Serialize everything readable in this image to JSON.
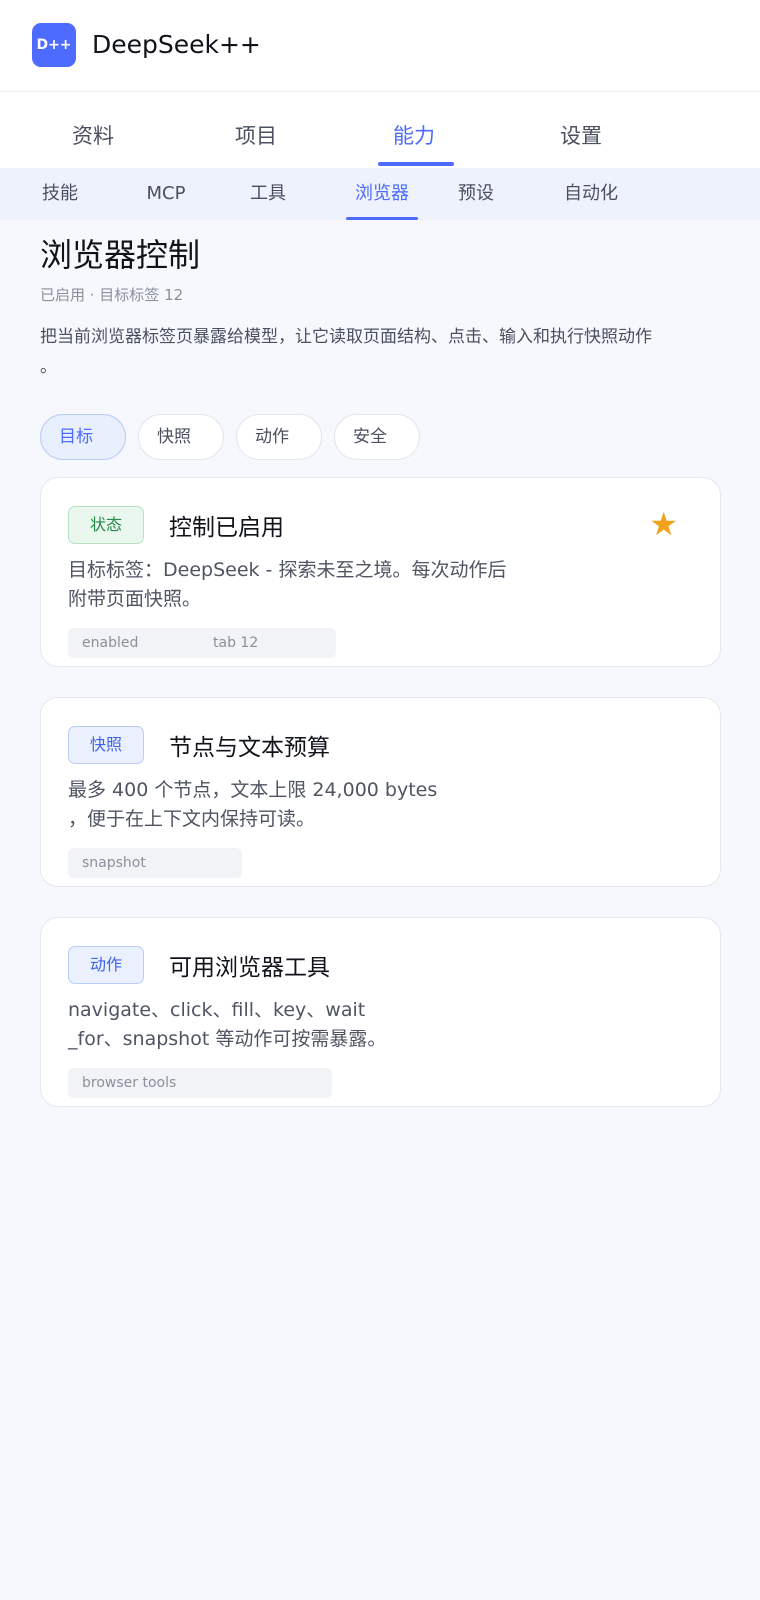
{
  "app": {
    "logo_text": "D++",
    "title": "DeepSeek++",
    "brand_color": "#4d6bfe"
  },
  "top_tabs": [
    {
      "label": "资料",
      "active": false
    },
    {
      "label": "项目",
      "active": false
    },
    {
      "label": "能力",
      "active": true
    },
    {
      "label": "设置",
      "active": false
    }
  ],
  "sub_tabs": [
    {
      "label": "技能",
      "active": false
    },
    {
      "label": "MCP",
      "active": false
    },
    {
      "label": "工具",
      "active": false
    },
    {
      "label": "浏览器",
      "active": true
    },
    {
      "label": "预设",
      "active": false
    },
    {
      "label": "自动化",
      "active": false
    }
  ],
  "page": {
    "title": "浏览器控制",
    "meta": "已启用 · 目标标签 12",
    "description": "把当前浏览器标签页暴露给模型，让它读取页面结构、点击、输入和执行快照动作\n。"
  },
  "filters": [
    {
      "label": "目标",
      "active": true
    },
    {
      "label": "快照",
      "active": false
    },
    {
      "label": "动作",
      "active": false
    },
    {
      "label": "安全",
      "active": false
    }
  ],
  "cards": [
    {
      "badge": "状态",
      "badge_color": "green",
      "title": "控制已启用",
      "body": "目标标签：DeepSeek - 探索未至之境。每次动作后\n附带页面快照。",
      "tags": [
        "enabled",
        "tab 12"
      ],
      "starred": true,
      "star_icon": "star-icon"
    },
    {
      "badge": "快照",
      "badge_color": "blue",
      "title": "节点与文本预算",
      "body": "最多 400 个节点，文本上限 24,000 bytes\n，便于在上下文内保持可读。",
      "tags": [
        "snapshot"
      ]
    },
    {
      "badge": "动作",
      "badge_color": "blue",
      "title": "可用浏览器工具",
      "body": "navigate、click、fill、key、wait\n_for、snapshot 等动作可按需暴露。",
      "tags": [
        "browser tools"
      ]
    }
  ]
}
